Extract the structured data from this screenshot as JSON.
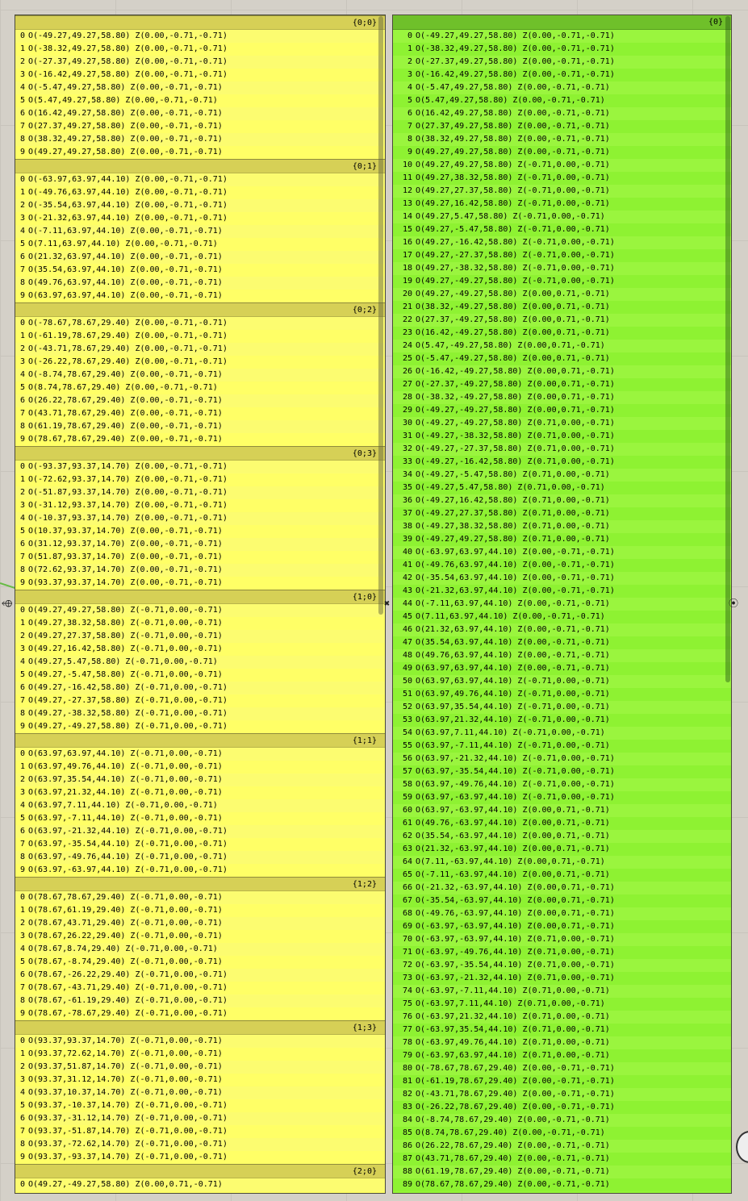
{
  "left_panel": {
    "sections": [
      {
        "path": "{0;0}",
        "items": [
          "O(-49.27,49.27,58.80) Z(0.00,-0.71,-0.71)",
          "O(-38.32,49.27,58.80) Z(0.00,-0.71,-0.71)",
          "O(-27.37,49.27,58.80) Z(0.00,-0.71,-0.71)",
          "O(-16.42,49.27,58.80) Z(0.00,-0.71,-0.71)",
          "O(-5.47,49.27,58.80) Z(0.00,-0.71,-0.71)",
          "O(5.47,49.27,58.80) Z(0.00,-0.71,-0.71)",
          "O(16.42,49.27,58.80) Z(0.00,-0.71,-0.71)",
          "O(27.37,49.27,58.80) Z(0.00,-0.71,-0.71)",
          "O(38.32,49.27,58.80) Z(0.00,-0.71,-0.71)",
          "O(49.27,49.27,58.80) Z(0.00,-0.71,-0.71)"
        ]
      },
      {
        "path": "{0;1}",
        "items": [
          "O(-63.97,63.97,44.10) Z(0.00,-0.71,-0.71)",
          "O(-49.76,63.97,44.10) Z(0.00,-0.71,-0.71)",
          "O(-35.54,63.97,44.10) Z(0.00,-0.71,-0.71)",
          "O(-21.32,63.97,44.10) Z(0.00,-0.71,-0.71)",
          "O(-7.11,63.97,44.10) Z(0.00,-0.71,-0.71)",
          "O(7.11,63.97,44.10) Z(0.00,-0.71,-0.71)",
          "O(21.32,63.97,44.10) Z(0.00,-0.71,-0.71)",
          "O(35.54,63.97,44.10) Z(0.00,-0.71,-0.71)",
          "O(49.76,63.97,44.10) Z(0.00,-0.71,-0.71)",
          "O(63.97,63.97,44.10) Z(0.00,-0.71,-0.71)"
        ]
      },
      {
        "path": "{0;2}",
        "items": [
          "O(-78.67,78.67,29.40) Z(0.00,-0.71,-0.71)",
          "O(-61.19,78.67,29.40) Z(0.00,-0.71,-0.71)",
          "O(-43.71,78.67,29.40) Z(0.00,-0.71,-0.71)",
          "O(-26.22,78.67,29.40) Z(0.00,-0.71,-0.71)",
          "O(-8.74,78.67,29.40) Z(0.00,-0.71,-0.71)",
          "O(8.74,78.67,29.40) Z(0.00,-0.71,-0.71)",
          "O(26.22,78.67,29.40) Z(0.00,-0.71,-0.71)",
          "O(43.71,78.67,29.40) Z(0.00,-0.71,-0.71)",
          "O(61.19,78.67,29.40) Z(0.00,-0.71,-0.71)",
          "O(78.67,78.67,29.40) Z(0.00,-0.71,-0.71)"
        ]
      },
      {
        "path": "{0;3}",
        "items": [
          "O(-93.37,93.37,14.70) Z(0.00,-0.71,-0.71)",
          "O(-72.62,93.37,14.70) Z(0.00,-0.71,-0.71)",
          "O(-51.87,93.37,14.70) Z(0.00,-0.71,-0.71)",
          "O(-31.12,93.37,14.70) Z(0.00,-0.71,-0.71)",
          "O(-10.37,93.37,14.70) Z(0.00,-0.71,-0.71)",
          "O(10.37,93.37,14.70) Z(0.00,-0.71,-0.71)",
          "O(31.12,93.37,14.70) Z(0.00,-0.71,-0.71)",
          "O(51.87,93.37,14.70) Z(0.00,-0.71,-0.71)",
          "O(72.62,93.37,14.70) Z(0.00,-0.71,-0.71)",
          "O(93.37,93.37,14.70) Z(0.00,-0.71,-0.71)"
        ]
      },
      {
        "path": "{1;0}",
        "items": [
          "O(49.27,49.27,58.80) Z(-0.71,0.00,-0.71)",
          "O(49.27,38.32,58.80) Z(-0.71,0.00,-0.71)",
          "O(49.27,27.37,58.80) Z(-0.71,0.00,-0.71)",
          "O(49.27,16.42,58.80) Z(-0.71,0.00,-0.71)",
          "O(49.27,5.47,58.80) Z(-0.71,0.00,-0.71)",
          "O(49.27,-5.47,58.80) Z(-0.71,0.00,-0.71)",
          "O(49.27,-16.42,58.80) Z(-0.71,0.00,-0.71)",
          "O(49.27,-27.37,58.80) Z(-0.71,0.00,-0.71)",
          "O(49.27,-38.32,58.80) Z(-0.71,0.00,-0.71)",
          "O(49.27,-49.27,58.80) Z(-0.71,0.00,-0.71)"
        ]
      },
      {
        "path": "{1;1}",
        "items": [
          "O(63.97,63.97,44.10) Z(-0.71,0.00,-0.71)",
          "O(63.97,49.76,44.10) Z(-0.71,0.00,-0.71)",
          "O(63.97,35.54,44.10) Z(-0.71,0.00,-0.71)",
          "O(63.97,21.32,44.10) Z(-0.71,0.00,-0.71)",
          "O(63.97,7.11,44.10) Z(-0.71,0.00,-0.71)",
          "O(63.97,-7.11,44.10) Z(-0.71,0.00,-0.71)",
          "O(63.97,-21.32,44.10) Z(-0.71,0.00,-0.71)",
          "O(63.97,-35.54,44.10) Z(-0.71,0.00,-0.71)",
          "O(63.97,-49.76,44.10) Z(-0.71,0.00,-0.71)",
          "O(63.97,-63.97,44.10) Z(-0.71,0.00,-0.71)"
        ]
      },
      {
        "path": "{1;2}",
        "items": [
          "O(78.67,78.67,29.40) Z(-0.71,0.00,-0.71)",
          "O(78.67,61.19,29.40) Z(-0.71,0.00,-0.71)",
          "O(78.67,43.71,29.40) Z(-0.71,0.00,-0.71)",
          "O(78.67,26.22,29.40) Z(-0.71,0.00,-0.71)",
          "O(78.67,8.74,29.40) Z(-0.71,0.00,-0.71)",
          "O(78.67,-8.74,29.40) Z(-0.71,0.00,-0.71)",
          "O(78.67,-26.22,29.40) Z(-0.71,0.00,-0.71)",
          "O(78.67,-43.71,29.40) Z(-0.71,0.00,-0.71)",
          "O(78.67,-61.19,29.40) Z(-0.71,0.00,-0.71)",
          "O(78.67,-78.67,29.40) Z(-0.71,0.00,-0.71)"
        ]
      },
      {
        "path": "{1;3}",
        "items": [
          "O(93.37,93.37,14.70) Z(-0.71,0.00,-0.71)",
          "O(93.37,72.62,14.70) Z(-0.71,0.00,-0.71)",
          "O(93.37,51.87,14.70) Z(-0.71,0.00,-0.71)",
          "O(93.37,31.12,14.70) Z(-0.71,0.00,-0.71)",
          "O(93.37,10.37,14.70) Z(-0.71,0.00,-0.71)",
          "O(93.37,-10.37,14.70) Z(-0.71,0.00,-0.71)",
          "O(93.37,-31.12,14.70) Z(-0.71,0.00,-0.71)",
          "O(93.37,-51.87,14.70) Z(-0.71,0.00,-0.71)",
          "O(93.37,-72.62,14.70) Z(-0.71,0.00,-0.71)",
          "O(93.37,-93.37,14.70) Z(-0.71,0.00,-0.71)"
        ]
      },
      {
        "path": "{2;0}",
        "items": [
          "O(49.27,-49.27,58.80) Z(0.00,0.71,-0.71)"
        ]
      }
    ]
  },
  "right_panel": {
    "path": "{0}",
    "items": [
      "O(-49.27,49.27,58.80) Z(0.00,-0.71,-0.71)",
      "O(-38.32,49.27,58.80) Z(0.00,-0.71,-0.71)",
      "O(-27.37,49.27,58.80) Z(0.00,-0.71,-0.71)",
      "O(-16.42,49.27,58.80) Z(0.00,-0.71,-0.71)",
      "O(-5.47,49.27,58.80) Z(0.00,-0.71,-0.71)",
      "O(5.47,49.27,58.80) Z(0.00,-0.71,-0.71)",
      "O(16.42,49.27,58.80) Z(0.00,-0.71,-0.71)",
      "O(27.37,49.27,58.80) Z(0.00,-0.71,-0.71)",
      "O(38.32,49.27,58.80) Z(0.00,-0.71,-0.71)",
      "O(49.27,49.27,58.80) Z(0.00,-0.71,-0.71)",
      "O(49.27,49.27,58.80) Z(-0.71,0.00,-0.71)",
      "O(49.27,38.32,58.80) Z(-0.71,0.00,-0.71)",
      "O(49.27,27.37,58.80) Z(-0.71,0.00,-0.71)",
      "O(49.27,16.42,58.80) Z(-0.71,0.00,-0.71)",
      "O(49.27,5.47,58.80) Z(-0.71,0.00,-0.71)",
      "O(49.27,-5.47,58.80) Z(-0.71,0.00,-0.71)",
      "O(49.27,-16.42,58.80) Z(-0.71,0.00,-0.71)",
      "O(49.27,-27.37,58.80) Z(-0.71,0.00,-0.71)",
      "O(49.27,-38.32,58.80) Z(-0.71,0.00,-0.71)",
      "O(49.27,-49.27,58.80) Z(-0.71,0.00,-0.71)",
      "O(49.27,-49.27,58.80) Z(0.00,0.71,-0.71)",
      "O(38.32,-49.27,58.80) Z(0.00,0.71,-0.71)",
      "O(27.37,-49.27,58.80) Z(0.00,0.71,-0.71)",
      "O(16.42,-49.27,58.80) Z(0.00,0.71,-0.71)",
      "O(5.47,-49.27,58.80) Z(0.00,0.71,-0.71)",
      "O(-5.47,-49.27,58.80) Z(0.00,0.71,-0.71)",
      "O(-16.42,-49.27,58.80) Z(0.00,0.71,-0.71)",
      "O(-27.37,-49.27,58.80) Z(0.00,0.71,-0.71)",
      "O(-38.32,-49.27,58.80) Z(0.00,0.71,-0.71)",
      "O(-49.27,-49.27,58.80) Z(0.00,0.71,-0.71)",
      "O(-49.27,-49.27,58.80) Z(0.71,0.00,-0.71)",
      "O(-49.27,-38.32,58.80) Z(0.71,0.00,-0.71)",
      "O(-49.27,-27.37,58.80) Z(0.71,0.00,-0.71)",
      "O(-49.27,-16.42,58.80) Z(0.71,0.00,-0.71)",
      "O(-49.27,-5.47,58.80) Z(0.71,0.00,-0.71)",
      "O(-49.27,5.47,58.80) Z(0.71,0.00,-0.71)",
      "O(-49.27,16.42,58.80) Z(0.71,0.00,-0.71)",
      "O(-49.27,27.37,58.80) Z(0.71,0.00,-0.71)",
      "O(-49.27,38.32,58.80) Z(0.71,0.00,-0.71)",
      "O(-49.27,49.27,58.80) Z(0.71,0.00,-0.71)",
      "O(-63.97,63.97,44.10) Z(0.00,-0.71,-0.71)",
      "O(-49.76,63.97,44.10) Z(0.00,-0.71,-0.71)",
      "O(-35.54,63.97,44.10) Z(0.00,-0.71,-0.71)",
      "O(-21.32,63.97,44.10) Z(0.00,-0.71,-0.71)",
      "O(-7.11,63.97,44.10) Z(0.00,-0.71,-0.71)",
      "O(7.11,63.97,44.10) Z(0.00,-0.71,-0.71)",
      "O(21.32,63.97,44.10) Z(0.00,-0.71,-0.71)",
      "O(35.54,63.97,44.10) Z(0.00,-0.71,-0.71)",
      "O(49.76,63.97,44.10) Z(0.00,-0.71,-0.71)",
      "O(63.97,63.97,44.10) Z(0.00,-0.71,-0.71)",
      "O(63.97,63.97,44.10) Z(-0.71,0.00,-0.71)",
      "O(63.97,49.76,44.10) Z(-0.71,0.00,-0.71)",
      "O(63.97,35.54,44.10) Z(-0.71,0.00,-0.71)",
      "O(63.97,21.32,44.10) Z(-0.71,0.00,-0.71)",
      "O(63.97,7.11,44.10) Z(-0.71,0.00,-0.71)",
      "O(63.97,-7.11,44.10) Z(-0.71,0.00,-0.71)",
      "O(63.97,-21.32,44.10) Z(-0.71,0.00,-0.71)",
      "O(63.97,-35.54,44.10) Z(-0.71,0.00,-0.71)",
      "O(63.97,-49.76,44.10) Z(-0.71,0.00,-0.71)",
      "O(63.97,-63.97,44.10) Z(-0.71,0.00,-0.71)",
      "O(63.97,-63.97,44.10) Z(0.00,0.71,-0.71)",
      "O(49.76,-63.97,44.10) Z(0.00,0.71,-0.71)",
      "O(35.54,-63.97,44.10) Z(0.00,0.71,-0.71)",
      "O(21.32,-63.97,44.10) Z(0.00,0.71,-0.71)",
      "O(7.11,-63.97,44.10) Z(0.00,0.71,-0.71)",
      "O(-7.11,-63.97,44.10) Z(0.00,0.71,-0.71)",
      "O(-21.32,-63.97,44.10) Z(0.00,0.71,-0.71)",
      "O(-35.54,-63.97,44.10) Z(0.00,0.71,-0.71)",
      "O(-49.76,-63.97,44.10) Z(0.00,0.71,-0.71)",
      "O(-63.97,-63.97,44.10) Z(0.00,0.71,-0.71)",
      "O(-63.97,-63.97,44.10) Z(0.71,0.00,-0.71)",
      "O(-63.97,-49.76,44.10) Z(0.71,0.00,-0.71)",
      "O(-63.97,-35.54,44.10) Z(0.71,0.00,-0.71)",
      "O(-63.97,-21.32,44.10) Z(0.71,0.00,-0.71)",
      "O(-63.97,-7.11,44.10) Z(0.71,0.00,-0.71)",
      "O(-63.97,7.11,44.10) Z(0.71,0.00,-0.71)",
      "O(-63.97,21.32,44.10) Z(0.71,0.00,-0.71)",
      "O(-63.97,35.54,44.10) Z(0.71,0.00,-0.71)",
      "O(-63.97,49.76,44.10) Z(0.71,0.00,-0.71)",
      "O(-63.97,63.97,44.10) Z(0.71,0.00,-0.71)",
      "O(-78.67,78.67,29.40) Z(0.00,-0.71,-0.71)",
      "O(-61.19,78.67,29.40) Z(0.00,-0.71,-0.71)",
      "O(-43.71,78.67,29.40) Z(0.00,-0.71,-0.71)",
      "O(-26.22,78.67,29.40) Z(0.00,-0.71,-0.71)",
      "O(-8.74,78.67,29.40) Z(0.00,-0.71,-0.71)",
      "O(8.74,78.67,29.40) Z(0.00,-0.71,-0.71)",
      "O(26.22,78.67,29.40) Z(0.00,-0.71,-0.71)",
      "O(43.71,78.67,29.40) Z(0.00,-0.71,-0.71)",
      "O(61.19,78.67,29.40) Z(0.00,-0.71,-0.71)",
      "O(78.67,78.67,29.40) Z(0.00,-0.71,-0.71)"
    ]
  }
}
